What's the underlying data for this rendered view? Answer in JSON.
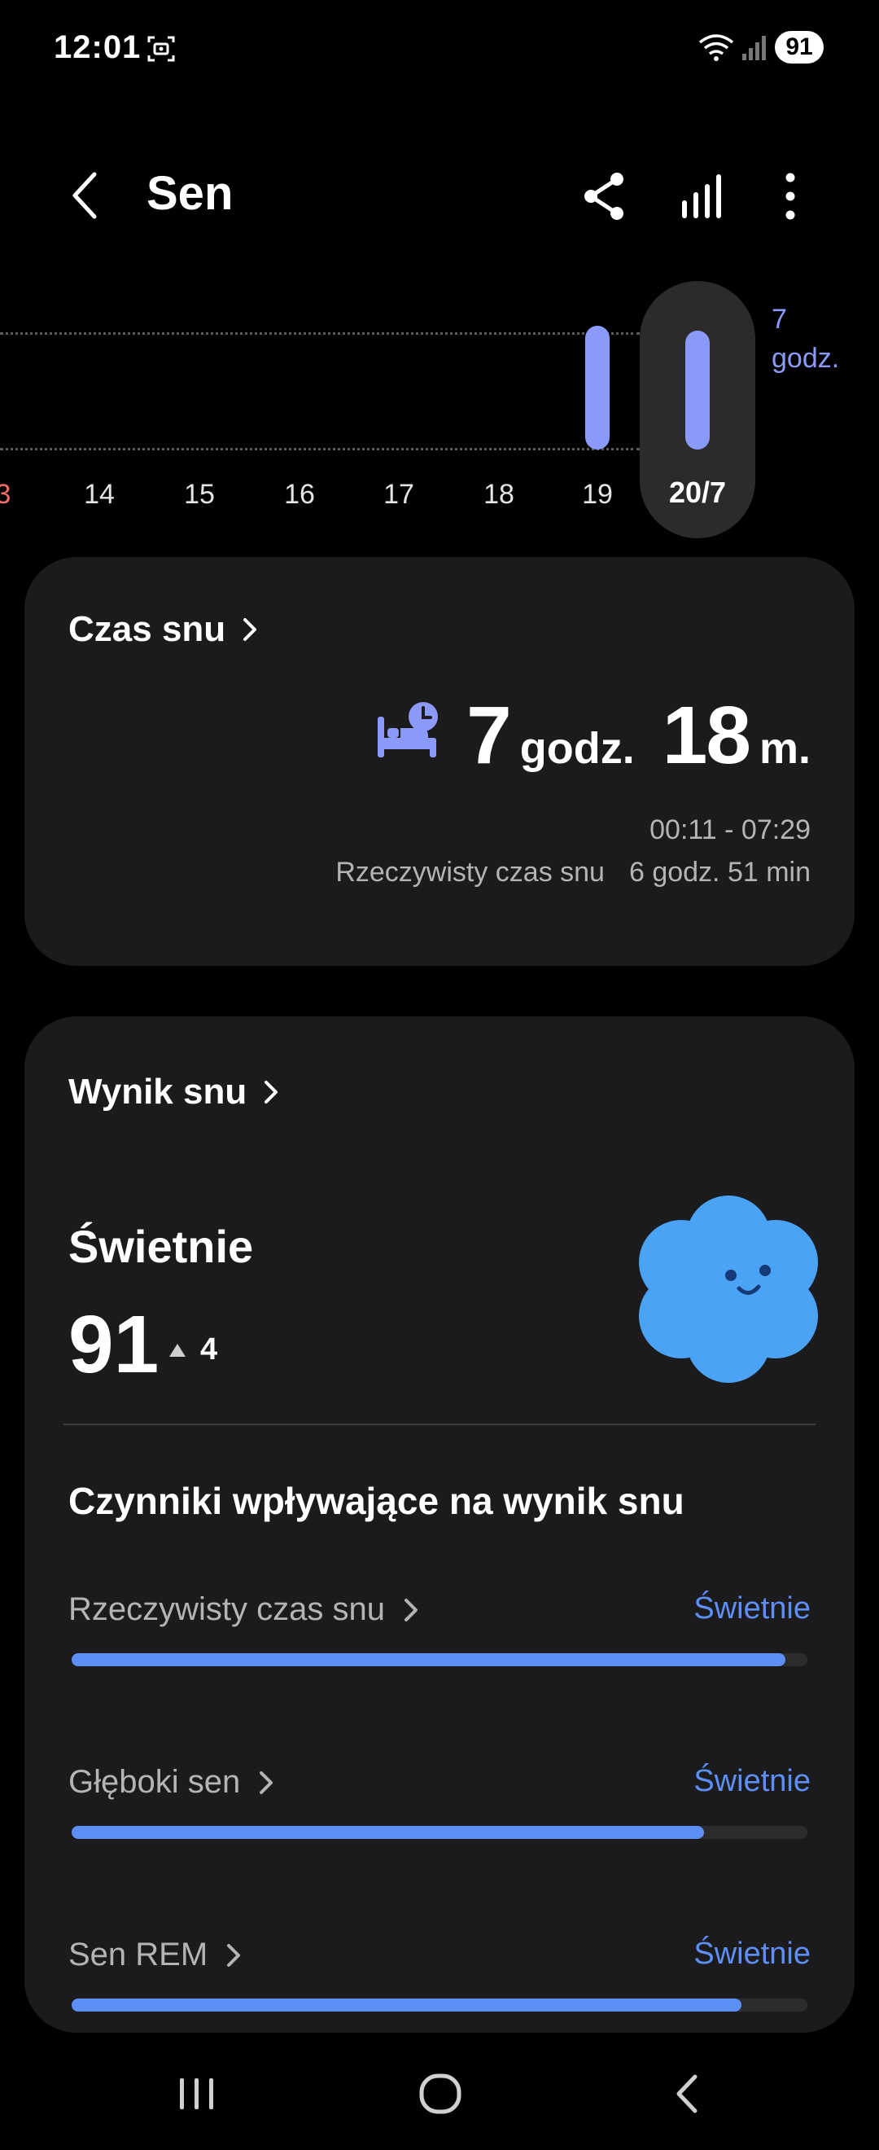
{
  "status": {
    "time": "12:01",
    "battery": "91"
  },
  "header": {
    "title": "Sen"
  },
  "timeline": {
    "days": [
      "3",
      "14",
      "15",
      "16",
      "17",
      "18",
      "19"
    ],
    "selected": "20/7",
    "goal_line1": "7",
    "goal_line2": "godz."
  },
  "sleep_time": {
    "title": "Czas snu",
    "hours": "7",
    "hours_unit": "godz.",
    "minutes": "18",
    "minutes_unit": "m.",
    "range": "00:11 - 07:29",
    "actual_label": "Rzeczywisty czas snu",
    "actual_value": "6 godz. 51 min"
  },
  "sleep_score": {
    "title": "Wynik snu",
    "rating": "Świetnie",
    "score": "91",
    "delta": "4",
    "factors_title": "Czynniki wpływające na wynik snu",
    "factors": [
      {
        "name": "Rzeczywisty czas snu",
        "rating": "Świetnie",
        "level": 0.97
      },
      {
        "name": "Głęboki sen",
        "rating": "Świetnie",
        "level": 0.86
      },
      {
        "name": "Sen REM",
        "rating": "Świetnie",
        "level": 0.91
      }
    ]
  },
  "colors": {
    "accent": "#8b99f8",
    "progress": "#5d8ff7",
    "card": "#1b1b1d"
  }
}
